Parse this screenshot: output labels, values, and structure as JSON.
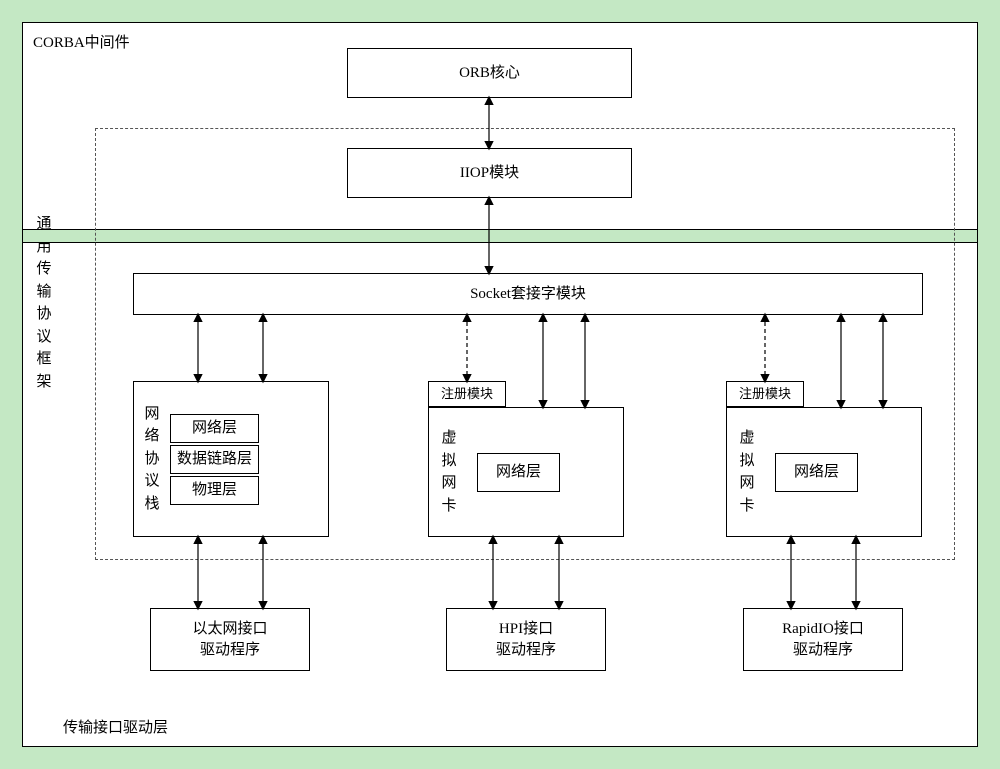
{
  "labels": {
    "corba": "CORBA中间件",
    "framework_vert": "通用传输协议框架",
    "driver_layer": "传输接口驱动层"
  },
  "top": {
    "orb": "ORB核心",
    "iiop": "IIOP模块"
  },
  "mid": {
    "socket": "Socket套接字模块",
    "reg1": "注册模块",
    "reg2": "注册模块",
    "stack_label": "网络协议栈",
    "net_layer": "网络层",
    "datalink": "数据链路层",
    "phys": "物理层",
    "vnic1_label": "虚拟网卡",
    "vnic1_net": "网络层",
    "vnic2_label": "虚拟网卡",
    "vnic2_net": "网络层"
  },
  "drivers": {
    "eth": "以太网接口\n驱动程序",
    "hpi": "HPI接口\n驱动程序",
    "rio": "RapidIO接口\n驱动程序"
  }
}
